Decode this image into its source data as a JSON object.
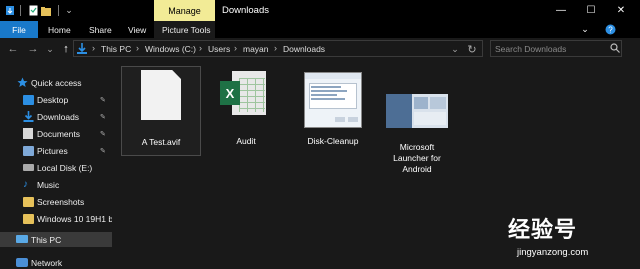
{
  "window": {
    "title": "Downloads",
    "manage_tab": "Manage",
    "minimize": "—",
    "maximize": "☐",
    "close": "✕"
  },
  "ribbon": {
    "tabs": [
      "File",
      "Home",
      "Share",
      "View",
      "Picture Tools"
    ],
    "colors": {
      "file_tab": "#1979ca",
      "manage_tab": "#f2eb96"
    }
  },
  "navigation": {
    "back": "←",
    "forward": "→",
    "recent": "⌄",
    "up": "↑"
  },
  "address": {
    "breadcrumbs": [
      "This PC",
      "Windows (C:)",
      "Users",
      "mayan",
      "Downloads"
    ],
    "separator": "›"
  },
  "search": {
    "placeholder": "Search Downloads"
  },
  "sidebar": {
    "items": [
      {
        "label": "Quick access",
        "icon": "star-icon"
      },
      {
        "label": "Desktop",
        "icon": "desktop-folder-icon",
        "pinned": true
      },
      {
        "label": "Downloads",
        "icon": "downloads-folder-icon",
        "pinned": true
      },
      {
        "label": "Documents",
        "icon": "documents-folder-icon",
        "pinned": true
      },
      {
        "label": "Pictures",
        "icon": "pictures-folder-icon",
        "pinned": true
      },
      {
        "label": "Local Disk (E:)",
        "icon": "drive-icon"
      },
      {
        "label": "Music",
        "icon": "music-icon"
      },
      {
        "label": "Screenshots",
        "icon": "folder-icon"
      },
      {
        "label": "Windows 10 19H1 b",
        "icon": "folder-icon"
      },
      {
        "label": "This PC",
        "icon": "computer-icon",
        "selected": true
      },
      {
        "label": "Network",
        "icon": "network-icon"
      }
    ],
    "pin_glyph": "📌"
  },
  "files": [
    {
      "name": "A Test.avif",
      "type": "generic-file",
      "selected": true
    },
    {
      "name": "Audit",
      "type": "excel-file"
    },
    {
      "name": "Disk-Cleanup",
      "type": "image-thumbnail"
    },
    {
      "name": "Microsoft Launcher for Android",
      "lines": [
        "Microsoft",
        "Launcher for",
        "Android"
      ],
      "type": "image-thumbnail"
    }
  ],
  "watermark": {
    "text": "经验号",
    "url": "jingyanzong.com"
  }
}
